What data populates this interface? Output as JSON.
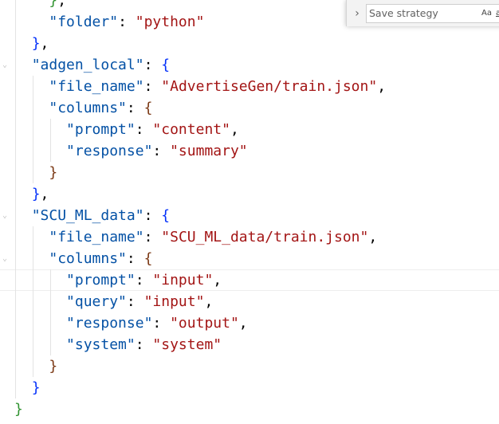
{
  "editor": {
    "lines": [
      [
        {
          "t": "    "
        },
        {
          "t": "}",
          "c": "b2"
        },
        {
          "t": ","
        }
      ],
      [
        {
          "t": "    "
        },
        {
          "t": "\"folder\"",
          "c": "k"
        },
        {
          "t": ": "
        },
        {
          "t": "\"python\"",
          "c": "s"
        }
      ],
      [
        {
          "t": "  "
        },
        {
          "t": "}",
          "c": "b1"
        },
        {
          "t": ","
        }
      ],
      [
        {
          "t": "  "
        },
        {
          "t": "\"adgen_local\"",
          "c": "k"
        },
        {
          "t": ": "
        },
        {
          "t": "{",
          "c": "b1"
        }
      ],
      [
        {
          "t": "    "
        },
        {
          "t": "\"file_name\"",
          "c": "k"
        },
        {
          "t": ": "
        },
        {
          "t": "\"AdvertiseGen/train.json\"",
          "c": "s"
        },
        {
          "t": ","
        }
      ],
      [
        {
          "t": "    "
        },
        {
          "t": "\"columns\"",
          "c": "k"
        },
        {
          "t": ": "
        },
        {
          "t": "{",
          "c": "b3"
        }
      ],
      [
        {
          "t": "      "
        },
        {
          "t": "\"prompt\"",
          "c": "k"
        },
        {
          "t": ": "
        },
        {
          "t": "\"content\"",
          "c": "s"
        },
        {
          "t": ","
        }
      ],
      [
        {
          "t": "      "
        },
        {
          "t": "\"response\"",
          "c": "k"
        },
        {
          "t": ": "
        },
        {
          "t": "\"summary\"",
          "c": "s"
        }
      ],
      [
        {
          "t": "    "
        },
        {
          "t": "}",
          "c": "b3"
        }
      ],
      [
        {
          "t": "  "
        },
        {
          "t": "}",
          "c": "b1"
        },
        {
          "t": ","
        }
      ],
      [
        {
          "t": "  "
        },
        {
          "t": "\"SCU_ML_data\"",
          "c": "k"
        },
        {
          "t": ": "
        },
        {
          "t": "{",
          "c": "b1"
        }
      ],
      [
        {
          "t": "    "
        },
        {
          "t": "\"file_name\"",
          "c": "k"
        },
        {
          "t": ": "
        },
        {
          "t": "\"SCU_ML_data/train.json\"",
          "c": "s"
        },
        {
          "t": ","
        }
      ],
      [
        {
          "t": "    "
        },
        {
          "t": "\"columns\"",
          "c": "k"
        },
        {
          "t": ": "
        },
        {
          "t": "{",
          "c": "b3"
        }
      ],
      [
        {
          "t": "      "
        },
        {
          "t": "\"prompt\"",
          "c": "k"
        },
        {
          "t": ": "
        },
        {
          "t": "\"input\"",
          "c": "s"
        },
        {
          "t": ","
        }
      ],
      [
        {
          "t": "      "
        },
        {
          "t": "\"query\"",
          "c": "k"
        },
        {
          "t": ": "
        },
        {
          "t": "\"input\"",
          "c": "s"
        },
        {
          "t": ","
        }
      ],
      [
        {
          "t": "      "
        },
        {
          "t": "\"response\"",
          "c": "k"
        },
        {
          "t": ": "
        },
        {
          "t": "\"output\"",
          "c": "s"
        },
        {
          "t": ","
        }
      ],
      [
        {
          "t": "      "
        },
        {
          "t": "\"system\"",
          "c": "k"
        },
        {
          "t": ": "
        },
        {
          "t": "\"system\"",
          "c": "s"
        }
      ],
      [
        {
          "t": "    "
        },
        {
          "t": "}",
          "c": "b3"
        }
      ],
      [
        {
          "t": "  "
        },
        {
          "t": "}",
          "c": "b1"
        }
      ],
      [
        {
          "t": "}",
          "c": "b2"
        }
      ]
    ]
  },
  "find_widget": {
    "toggle_icon": "chevron-right-icon",
    "input_value": "Save strategy",
    "match_case_label": "Aa",
    "whole_word_label": "ab"
  },
  "colors": {
    "key": "#0451a5",
    "string": "#a31515",
    "bracket_level1": "#0431fa",
    "bracket_level2": "#319331",
    "bracket_level3": "#7b3814"
  }
}
